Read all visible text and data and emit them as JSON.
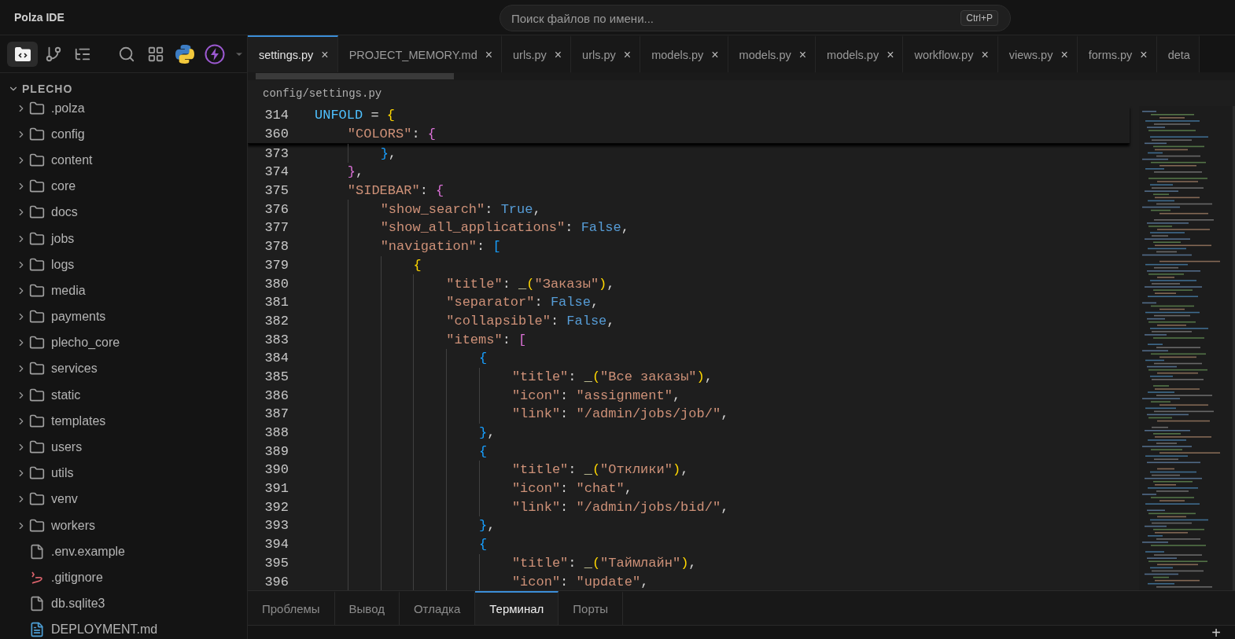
{
  "window": {
    "title": "Polza IDE"
  },
  "search": {
    "placeholder": "Поиск файлов по имени...",
    "shortcut": "Ctrl+P"
  },
  "activity": [
    {
      "kind": "files",
      "selected": true
    },
    {
      "kind": "branch",
      "selected": false
    },
    {
      "kind": "tree",
      "selected": false
    },
    {
      "kind": "search",
      "selected": false
    },
    {
      "kind": "grid",
      "selected": false
    },
    {
      "kind": "python",
      "selected": false
    },
    {
      "kind": "bolt",
      "selected": false
    },
    {
      "kind": "more",
      "selected": false
    }
  ],
  "explorer": {
    "root": "PLECHO",
    "expanded": true,
    "items": [
      {
        "kind": "folder",
        "name": ".polza",
        "expanded": false
      },
      {
        "kind": "folder",
        "name": "config",
        "expanded": false
      },
      {
        "kind": "folder",
        "name": "content",
        "expanded": false
      },
      {
        "kind": "folder",
        "name": "core",
        "expanded": false
      },
      {
        "kind": "folder",
        "name": "docs",
        "expanded": false
      },
      {
        "kind": "folder",
        "name": "jobs",
        "expanded": false
      },
      {
        "kind": "folder",
        "name": "logs",
        "expanded": false
      },
      {
        "kind": "folder",
        "name": "media",
        "expanded": false
      },
      {
        "kind": "folder",
        "name": "payments",
        "expanded": false
      },
      {
        "kind": "folder",
        "name": "plecho_core",
        "expanded": false
      },
      {
        "kind": "folder",
        "name": "services",
        "expanded": false
      },
      {
        "kind": "folder",
        "name": "static",
        "expanded": false
      },
      {
        "kind": "folder",
        "name": "templates",
        "expanded": false
      },
      {
        "kind": "folder",
        "name": "users",
        "expanded": false
      },
      {
        "kind": "folder",
        "name": "utils",
        "expanded": false
      },
      {
        "kind": "folder",
        "name": "venv",
        "expanded": false
      },
      {
        "kind": "folder",
        "name": "workers",
        "expanded": false
      },
      {
        "kind": "file",
        "name": ".env.example"
      },
      {
        "kind": "git",
        "name": ".gitignore"
      },
      {
        "kind": "file",
        "name": "db.sqlite3"
      },
      {
        "kind": "markdown",
        "name": "DEPLOYMENT.md"
      }
    ]
  },
  "tabs": [
    {
      "label": "settings.py",
      "selected": true,
      "close": "×"
    },
    {
      "label": "PROJECT_MEMORY.md",
      "selected": false,
      "close": "×"
    },
    {
      "label": "urls.py",
      "selected": false,
      "close": "×"
    },
    {
      "label": "urls.py",
      "selected": false,
      "close": "×"
    },
    {
      "label": "models.py",
      "selected": false,
      "close": "×"
    },
    {
      "label": "models.py",
      "selected": false,
      "close": "×"
    },
    {
      "label": "models.py",
      "selected": false,
      "close": "×"
    },
    {
      "label": "workflow.py",
      "selected": false,
      "close": "×"
    },
    {
      "label": "views.py",
      "selected": false,
      "close": "×"
    },
    {
      "label": "forms.py",
      "selected": false,
      "close": "×"
    },
    {
      "label": "deta",
      "selected": false
    }
  ],
  "breadcrumb": "config/settings.py",
  "sticky_lines": [
    {
      "number": "314",
      "tokens": [
        {
          "kind": "name",
          "text": "UNFOLD"
        },
        {
          "kind": "plain",
          "text": " = "
        },
        {
          "kind": "by",
          "text": "{"
        }
      ]
    },
    {
      "number": "360",
      "tokens": [
        {
          "kind": "key",
          "text": "    \"COLORS\""
        },
        {
          "kind": "plain",
          "text": ": "
        },
        {
          "kind": "bm",
          "text": "{"
        }
      ]
    }
  ],
  "lines": [
    {
      "number": "373",
      "tokens": [
        {
          "kind": "bb",
          "text": "        }"
        },
        {
          "kind": "plain",
          "text": ","
        }
      ]
    },
    {
      "number": "374",
      "tokens": [
        {
          "kind": "bm",
          "text": "    }"
        },
        {
          "kind": "plain",
          "text": ","
        }
      ]
    },
    {
      "number": "375",
      "tokens": [
        {
          "kind": "key",
          "text": "    \"SIDEBAR\""
        },
        {
          "kind": "plain",
          "text": ": "
        },
        {
          "kind": "bm",
          "text": "{"
        }
      ]
    },
    {
      "number": "376",
      "tokens": [
        {
          "kind": "key",
          "text": "        \"show_search\""
        },
        {
          "kind": "plain",
          "text": ": "
        },
        {
          "kind": "const",
          "text": "True"
        },
        {
          "kind": "plain",
          "text": ","
        }
      ]
    },
    {
      "number": "377",
      "tokens": [
        {
          "kind": "key",
          "text": "        \"show_all_applications\""
        },
        {
          "kind": "plain",
          "text": ": "
        },
        {
          "kind": "const",
          "text": "False"
        },
        {
          "kind": "plain",
          "text": ","
        }
      ]
    },
    {
      "number": "378",
      "tokens": [
        {
          "kind": "key",
          "text": "        \"navigation\""
        },
        {
          "kind": "plain",
          "text": ": "
        },
        {
          "kind": "bb",
          "text": "["
        }
      ]
    },
    {
      "number": "379",
      "tokens": [
        {
          "kind": "by",
          "text": "            {"
        }
      ]
    },
    {
      "number": "380",
      "tokens": [
        {
          "kind": "key",
          "text": "                \"title\""
        },
        {
          "kind": "plain",
          "text": ": "
        },
        {
          "kind": "func",
          "text": "_"
        },
        {
          "kind": "by",
          "text": "("
        },
        {
          "kind": "str",
          "text": "\"Заказы\""
        },
        {
          "kind": "by",
          "text": ")"
        },
        {
          "kind": "plain",
          "text": ","
        }
      ]
    },
    {
      "number": "381",
      "tokens": [
        {
          "kind": "key",
          "text": "                \"separator\""
        },
        {
          "kind": "plain",
          "text": ": "
        },
        {
          "kind": "const",
          "text": "False"
        },
        {
          "kind": "plain",
          "text": ","
        }
      ]
    },
    {
      "number": "382",
      "tokens": [
        {
          "kind": "key",
          "text": "                \"collapsible\""
        },
        {
          "kind": "plain",
          "text": ": "
        },
        {
          "kind": "const",
          "text": "False"
        },
        {
          "kind": "plain",
          "text": ","
        }
      ]
    },
    {
      "number": "383",
      "tokens": [
        {
          "kind": "key",
          "text": "                \"items\""
        },
        {
          "kind": "plain",
          "text": ": "
        },
        {
          "kind": "bm",
          "text": "["
        }
      ]
    },
    {
      "number": "384",
      "tokens": [
        {
          "kind": "bb",
          "text": "                    {"
        }
      ]
    },
    {
      "number": "385",
      "tokens": [
        {
          "kind": "key",
          "text": "                        \"title\""
        },
        {
          "kind": "plain",
          "text": ": "
        },
        {
          "kind": "func",
          "text": "_"
        },
        {
          "kind": "by",
          "text": "("
        },
        {
          "kind": "str",
          "text": "\"Все заказы\""
        },
        {
          "kind": "by",
          "text": ")"
        },
        {
          "kind": "plain",
          "text": ","
        }
      ]
    },
    {
      "number": "386",
      "tokens": [
        {
          "kind": "key",
          "text": "                        \"icon\""
        },
        {
          "kind": "plain",
          "text": ": "
        },
        {
          "kind": "str",
          "text": "\"assignment\""
        },
        {
          "kind": "plain",
          "text": ","
        }
      ]
    },
    {
      "number": "387",
      "tokens": [
        {
          "kind": "key",
          "text": "                        \"link\""
        },
        {
          "kind": "plain",
          "text": ": "
        },
        {
          "kind": "str",
          "text": "\"/admin/jobs/job/\""
        },
        {
          "kind": "plain",
          "text": ","
        }
      ]
    },
    {
      "number": "388",
      "tokens": [
        {
          "kind": "bb",
          "text": "                    }"
        },
        {
          "kind": "plain",
          "text": ","
        }
      ]
    },
    {
      "number": "389",
      "tokens": [
        {
          "kind": "bb",
          "text": "                    {"
        }
      ]
    },
    {
      "number": "390",
      "tokens": [
        {
          "kind": "key",
          "text": "                        \"title\""
        },
        {
          "kind": "plain",
          "text": ": "
        },
        {
          "kind": "func",
          "text": "_"
        },
        {
          "kind": "by",
          "text": "("
        },
        {
          "kind": "str",
          "text": "\"Отклики\""
        },
        {
          "kind": "by",
          "text": ")"
        },
        {
          "kind": "plain",
          "text": ","
        }
      ]
    },
    {
      "number": "391",
      "tokens": [
        {
          "kind": "key",
          "text": "                        \"icon\""
        },
        {
          "kind": "plain",
          "text": ": "
        },
        {
          "kind": "str",
          "text": "\"chat\""
        },
        {
          "kind": "plain",
          "text": ","
        }
      ]
    },
    {
      "number": "392",
      "tokens": [
        {
          "kind": "key",
          "text": "                        \"link\""
        },
        {
          "kind": "plain",
          "text": ": "
        },
        {
          "kind": "str",
          "text": "\"/admin/jobs/bid/\""
        },
        {
          "kind": "plain",
          "text": ","
        }
      ]
    },
    {
      "number": "393",
      "tokens": [
        {
          "kind": "bb",
          "text": "                    }"
        },
        {
          "kind": "plain",
          "text": ","
        }
      ]
    },
    {
      "number": "394",
      "tokens": [
        {
          "kind": "bb",
          "text": "                    {"
        }
      ]
    },
    {
      "number": "395",
      "tokens": [
        {
          "kind": "key",
          "text": "                        \"title\""
        },
        {
          "kind": "plain",
          "text": ": "
        },
        {
          "kind": "func",
          "text": "_"
        },
        {
          "kind": "by",
          "text": "("
        },
        {
          "kind": "str",
          "text": "\"Таймлайн\""
        },
        {
          "kind": "by",
          "text": ")"
        },
        {
          "kind": "plain",
          "text": ","
        }
      ]
    },
    {
      "number": "396",
      "tokens": [
        {
          "kind": "key",
          "text": "                        \"icon\""
        },
        {
          "kind": "plain",
          "text": ": "
        },
        {
          "kind": "str",
          "text": "\"update\""
        },
        {
          "kind": "plain",
          "text": ","
        }
      ]
    }
  ],
  "panel": {
    "tabs": [
      {
        "label": "Проблемы",
        "selected": false
      },
      {
        "label": "Вывод",
        "selected": false
      },
      {
        "label": "Отладка",
        "selected": false
      },
      {
        "label": "Терминал",
        "selected": true
      },
      {
        "label": "Порты",
        "selected": false
      }
    ],
    "add": "+"
  }
}
